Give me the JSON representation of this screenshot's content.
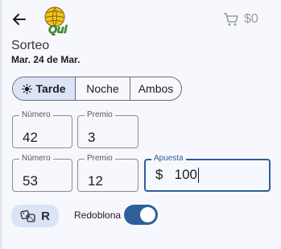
{
  "header": {
    "back_icon": "arrow-left-icon",
    "logo_text": "Qui",
    "cart_icon": "cart-icon",
    "balance": "$0"
  },
  "draw": {
    "title": "Sorteo",
    "date": "Mar. 24 de Mar."
  },
  "segments": {
    "items": [
      "Tarde",
      "Noche",
      "Ambos"
    ],
    "selected": "Tarde",
    "selected_icon": "sun-icon"
  },
  "row1": {
    "number_label": "Número",
    "number_value": "42",
    "prize_label": "Premio",
    "prize_value": "3"
  },
  "row2": {
    "number_label": "Número",
    "number_value": "53",
    "prize_label": "Premio",
    "prize_value": "12",
    "bet_label": "Apuesta",
    "bet_currency": "$",
    "bet_value": "100"
  },
  "footer": {
    "chip_icon": "dice-icon",
    "chip_letter": "R",
    "redoblona_label": "Redoblona",
    "redoblona_on": true
  },
  "colors": {
    "accent": "#2f5f98",
    "chip_bg": "#dbe3f7",
    "background": "#f7f8fe"
  }
}
